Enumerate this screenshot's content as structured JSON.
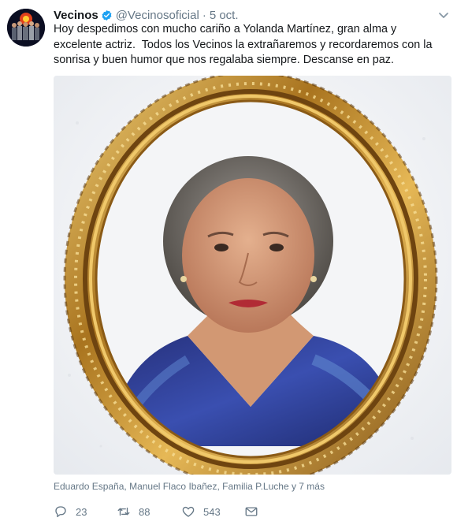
{
  "tweet": {
    "display_name": "Vecinos",
    "handle": "@Vecinosoficial",
    "separator": "·",
    "date": "5 oct.",
    "text": "Hoy despedimos con mucho cariño a Yolanda Martínez, gran alma y excelente actriz.  Todos los Vecinos la extrañaremos y recordaremos con la sonrisa y buen humor que nos regalaba siempre. Descanse en paz.",
    "tagged": "Eduardo España, Manuel Flaco Ibañez, Familia P.Luche y 7 más"
  },
  "actions": {
    "replies": "23",
    "retweets": "88",
    "likes": "543"
  },
  "icons": {
    "verified": "verified-badge-icon",
    "caret": "chevron-down-icon",
    "reply": "reply-icon",
    "retweet": "retweet-icon",
    "like": "heart-icon",
    "message": "envelope-icon"
  },
  "colors": {
    "verified_blue": "#1da1f2",
    "muted": "#657786",
    "text": "#14171a"
  }
}
